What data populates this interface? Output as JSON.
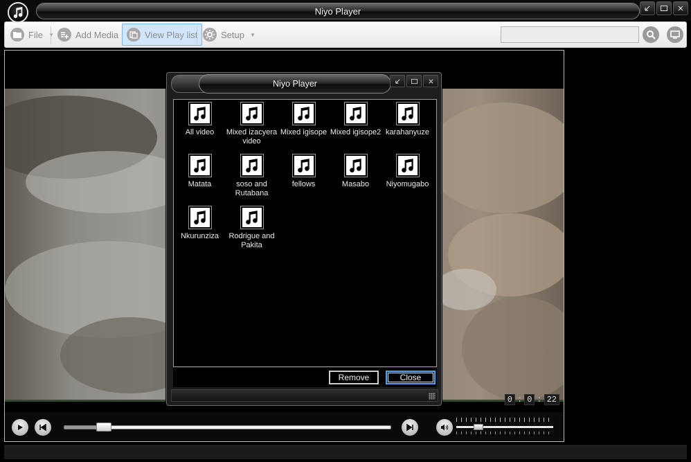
{
  "app": {
    "title": "Niyo Player",
    "icon": "music-note-icon"
  },
  "toolbar": {
    "file_label": "File",
    "add_media_label": "Add Media",
    "view_playlist_label": "View Play list",
    "setup_label": "Setup",
    "search_value": "",
    "search_placeholder": ""
  },
  "player": {
    "time": {
      "hours": "0",
      "minutes": "0",
      "seconds": "22"
    },
    "seek_progress": 0.12,
    "volume_level": 0.2
  },
  "dialog": {
    "title": "Niyo Player",
    "playlists": [
      {
        "name": "All video",
        "icon": "music-note-icon"
      },
      {
        "name": "Mixed izacyera video",
        "icon": "music-note-icon"
      },
      {
        "name": "Mixed igisope",
        "icon": "music-note-icon"
      },
      {
        "name": "Mixed igisope2",
        "icon": "music-note-icon"
      },
      {
        "name": "karahanyuze",
        "icon": "music-note-icon"
      },
      {
        "name": "Matata",
        "icon": "music-note-icon"
      },
      {
        "name": "soso and Rutabana",
        "icon": "music-note-icon"
      },
      {
        "name": "fellows",
        "icon": "music-note-icon"
      },
      {
        "name": "Masabo",
        "icon": "music-note-icon"
      },
      {
        "name": "Niyomugabo",
        "icon": "music-note-icon"
      },
      {
        "name": "Nkurunziza",
        "icon": "music-note-icon"
      },
      {
        "name": "Rodrigue and Pakita",
        "icon": "music-note-icon"
      }
    ],
    "remove_label": "Remove",
    "close_label": "Close"
  },
  "colors": {
    "accent_active": "#cfe6fb",
    "focus_border": "#4aa3ff"
  }
}
